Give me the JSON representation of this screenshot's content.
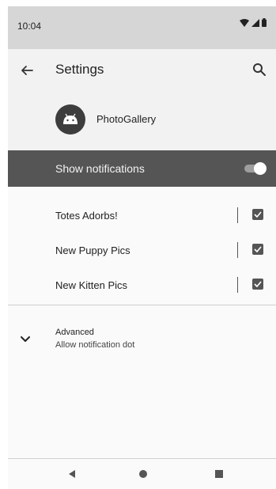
{
  "status_bar": {
    "time": "10:04",
    "icons": [
      "wifi-icon",
      "signal-icon",
      "battery-icon"
    ]
  },
  "app_bar": {
    "title": "Settings",
    "back_icon": "arrow-left-icon",
    "search_icon": "search-icon"
  },
  "app_info": {
    "name": "PhotoGallery",
    "icon": "android-icon"
  },
  "master_toggle": {
    "label": "Show notifications",
    "enabled": true
  },
  "channels": [
    {
      "label": "Totes Adorbs!",
      "checked": true
    },
    {
      "label": "New Puppy Pics",
      "checked": true
    },
    {
      "label": "New Kitten Pics",
      "checked": true
    }
  ],
  "advanced": {
    "title": "Advanced",
    "subtitle": "Allow notification dot",
    "icon": "chevron-down-icon"
  },
  "nav_bar": {
    "icons": [
      "back-triangle-icon",
      "home-circle-icon",
      "recents-square-icon"
    ]
  },
  "colors": {
    "master_bg": "#555555",
    "status_bg": "#d6d6d6",
    "app_bar_bg": "#f2f2f2"
  }
}
